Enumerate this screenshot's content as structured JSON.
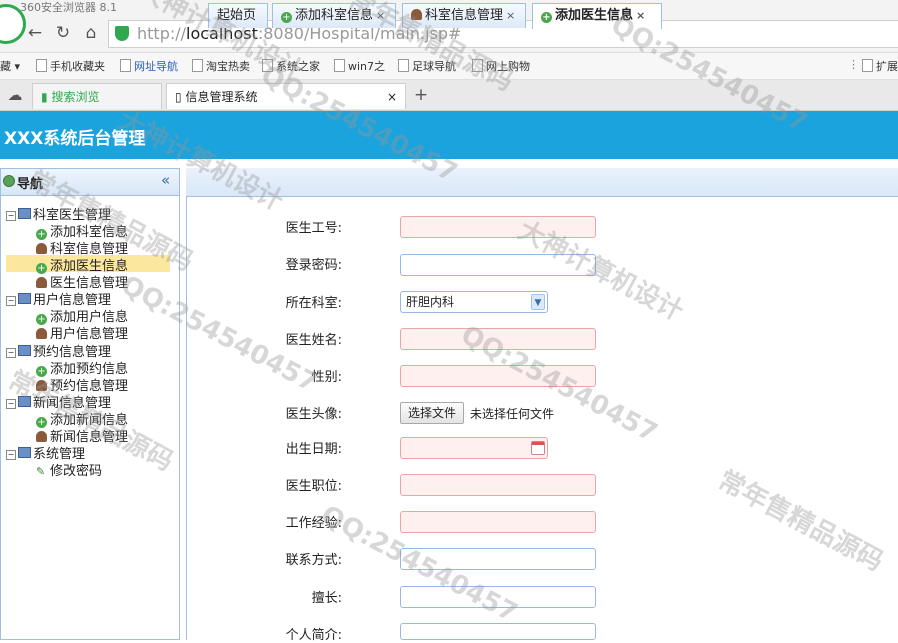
{
  "browser": {
    "app_name": "360安全浏览器 8.1",
    "url_prefix": "http://",
    "url_host": "localhost",
    "url_rest": ":8080/Hospital/main.jsp#",
    "bookmarks": [
      "藏",
      "手机收藏夹",
      "网址导航",
      "淘宝热卖",
      "系统之家",
      "win7之",
      "足球导航",
      "网上购物"
    ],
    "extension_label": "扩展",
    "tabs": [
      {
        "label": "搜索浏览"
      },
      {
        "label": "信息管理系统",
        "close": "×"
      }
    ],
    "new_tab": "+"
  },
  "app": {
    "title": "XXX系统后台管理"
  },
  "nav": {
    "title": "导航",
    "collapse_glyph": "«",
    "groups": [
      {
        "label": "科室医生管理",
        "items": [
          {
            "label": "添加科室信息",
            "icon": "add-icon"
          },
          {
            "label": "科室信息管理",
            "icon": "person-icon"
          },
          {
            "label": "添加医生信息",
            "icon": "add-icon",
            "selected": true
          },
          {
            "label": "医生信息管理",
            "icon": "person-icon"
          }
        ]
      },
      {
        "label": "用户信息管理",
        "items": [
          {
            "label": "添加用户信息",
            "icon": "add-icon"
          },
          {
            "label": "用户信息管理",
            "icon": "person-icon"
          }
        ]
      },
      {
        "label": "预约信息管理",
        "items": [
          {
            "label": "添加预约信息",
            "icon": "add-icon"
          },
          {
            "label": "预约信息管理",
            "icon": "person-icon"
          }
        ]
      },
      {
        "label": "新闻信息管理",
        "items": [
          {
            "label": "添加新闻信息",
            "icon": "add-icon"
          },
          {
            "label": "新闻信息管理",
            "icon": "person-icon"
          }
        ]
      },
      {
        "label": "系统管理",
        "items": [
          {
            "label": "修改密码",
            "icon": "pencil-icon"
          }
        ]
      }
    ]
  },
  "tabs": [
    {
      "label": "起始页"
    },
    {
      "label": "添加科室信息",
      "close": "×"
    },
    {
      "label": "科室信息管理",
      "close": "×"
    },
    {
      "label": "添加医生信息",
      "close": "×",
      "active": true
    }
  ],
  "form": {
    "doctor_id_label": "医生工号:",
    "password_label": "登录密码:",
    "department_label": "所在科室:",
    "department_value": "肝胆内科",
    "name_label": "医生姓名:",
    "gender_label": "性别:",
    "photo_label": "医生头像:",
    "choose_file_button": "选择文件",
    "no_file_text": "未选择任何文件",
    "birth_label": "出生日期:",
    "title_label": "医生职位:",
    "experience_label": "工作经验:",
    "contact_label": "联系方式:",
    "specialty_label": "擅长:",
    "intro_label": "个人简介:"
  },
  "watermarks": [
    "大神计算机设计",
    "常年售精品源码",
    "QQ:254540457",
    "大神计算机设计",
    "QQ:254540457",
    "常年售精品源码",
    "大神计算机设计",
    "QQ:254540457",
    "QQ:254540457",
    "常年售精品源码",
    "QQ:254540457",
    "常年售精品源码"
  ],
  "colors": {
    "header_bg": "#1aa3dc",
    "selected_item_bg": "#fbe79d",
    "required_field_bg": "#fff0f0",
    "required_field_border": "#e8a6a6"
  }
}
